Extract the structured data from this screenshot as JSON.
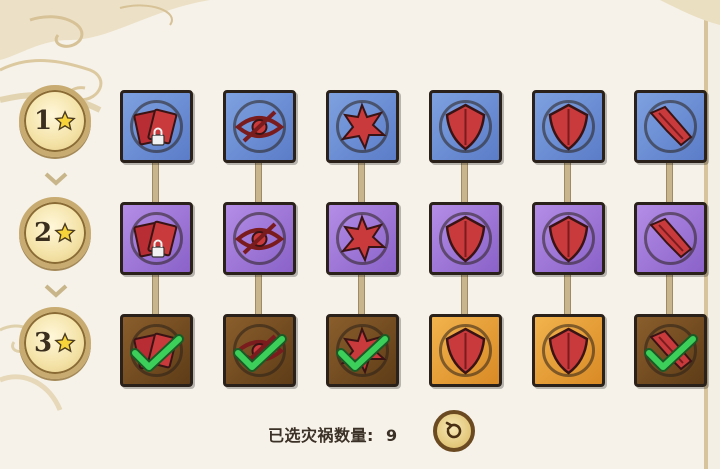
{
  "tiers": [
    {
      "label": "1",
      "icon": "star-icon"
    },
    {
      "label": "2",
      "icon": "star-icon"
    },
    {
      "label": "3",
      "icon": "star-icon"
    }
  ],
  "rows": [
    {
      "tier": "1",
      "color": "blue",
      "cards": [
        {
          "icon": "cards-lock-icon"
        },
        {
          "icon": "eye-slash-icon"
        },
        {
          "icon": "spiked-orb-icon"
        },
        {
          "icon": "shield-icon"
        },
        {
          "icon": "shield-icon"
        },
        {
          "icon": "crystal-shard-icon"
        }
      ]
    },
    {
      "tier": "2",
      "color": "purple",
      "cards": [
        {
          "icon": "cards-lock-icon"
        },
        {
          "icon": "eye-slash-icon"
        },
        {
          "icon": "spiked-orb-icon"
        },
        {
          "icon": "shield-icon"
        },
        {
          "icon": "shield-icon"
        },
        {
          "icon": "crystal-shard-icon"
        }
      ]
    },
    {
      "tier": "3",
      "cards": [
        {
          "icon": "cards-check-icon",
          "color": "brown",
          "selected": true
        },
        {
          "icon": "eye-slash-check-icon",
          "color": "brown",
          "selected": true
        },
        {
          "icon": "spiked-orb-check-icon",
          "color": "brown",
          "selected": true
        },
        {
          "icon": "shield-icon",
          "color": "orange",
          "selected": false
        },
        {
          "icon": "shield-icon",
          "color": "orange",
          "selected": false
        },
        {
          "icon": "crystal-shard-check-icon",
          "color": "brown",
          "selected": true
        }
      ]
    }
  ],
  "footer": {
    "counter_label": "已选灾祸数量:",
    "counter_value": "9",
    "reset_icon": "reset-arrow-icon"
  },
  "colors": {
    "blue": "#6a8cd6",
    "purple": "#9c73d6",
    "brown": "#6e4a22",
    "orange": "#e99e37",
    "emblem_red": "#c93a3c",
    "check_green": "#3ccf5a",
    "frame": "#2a211a"
  }
}
